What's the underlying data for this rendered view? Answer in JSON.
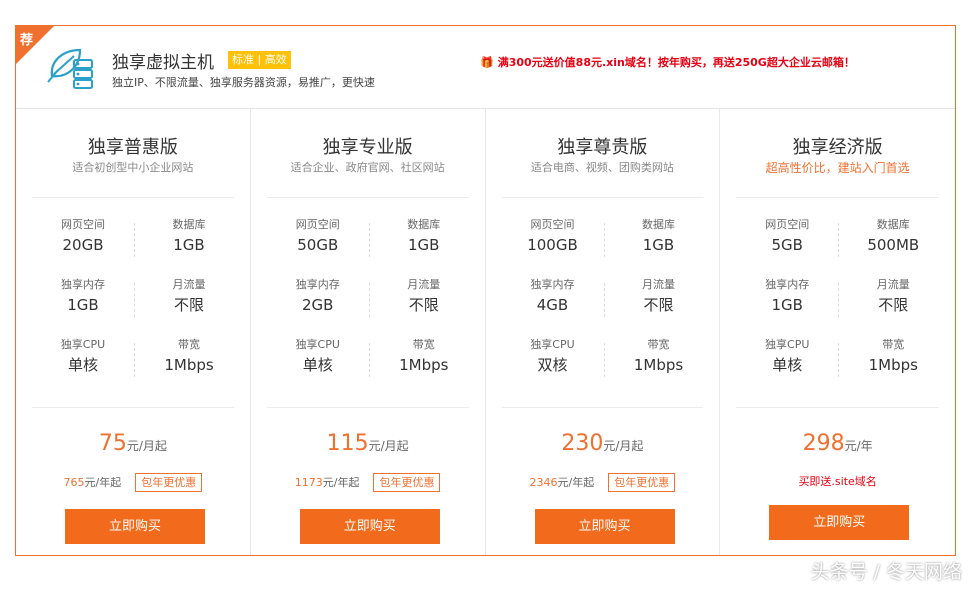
{
  "header": {
    "badge": "荐",
    "title": "独享虚拟主机",
    "tag": "标准 | 高效",
    "subtitle": "独立IP、不限流量、独享服务器资源，易推广，更快速",
    "promo": "满300元送价值88元.xin域名！按年购买，再送250G超大企业云邮箱！"
  },
  "plans": [
    {
      "name": "独享普惠版",
      "desc": "适合初创型中小企业网站",
      "specs": [
        {
          "label": "网页空间",
          "value": "20GB"
        },
        {
          "label": "数据库",
          "value": "1GB"
        },
        {
          "label": "独享内存",
          "value": "1GB"
        },
        {
          "label": "月流量",
          "value": "不限"
        },
        {
          "label": "独享CPU",
          "value": "单核"
        },
        {
          "label": "带宽",
          "value": "1Mbps"
        }
      ],
      "price": "75",
      "price_unit": "元/月起",
      "year_price": "765",
      "year_unit": "元/年起",
      "deal": "包年更优惠",
      "buy": "立即购买"
    },
    {
      "name": "独享专业版",
      "desc": "适合企业、政府官网、社区网站",
      "specs": [
        {
          "label": "网页空间",
          "value": "50GB"
        },
        {
          "label": "数据库",
          "value": "1GB"
        },
        {
          "label": "独享内存",
          "value": "2GB"
        },
        {
          "label": "月流量",
          "value": "不限"
        },
        {
          "label": "独享CPU",
          "value": "单核"
        },
        {
          "label": "带宽",
          "value": "1Mbps"
        }
      ],
      "price": "115",
      "price_unit": "元/月起",
      "year_price": "1173",
      "year_unit": "元/年起",
      "deal": "包年更优惠",
      "buy": "立即购买"
    },
    {
      "name": "独享尊贵版",
      "desc": "适合电商、视频、团购类网站",
      "specs": [
        {
          "label": "网页空间",
          "value": "100GB"
        },
        {
          "label": "数据库",
          "value": "1GB"
        },
        {
          "label": "独享内存",
          "value": "4GB"
        },
        {
          "label": "月流量",
          "value": "不限"
        },
        {
          "label": "独享CPU",
          "value": "双核"
        },
        {
          "label": "带宽",
          "value": "1Mbps"
        }
      ],
      "price": "230",
      "price_unit": "元/月起",
      "year_price": "2346",
      "year_unit": "元/年起",
      "deal": "包年更优惠",
      "buy": "立即购买"
    },
    {
      "name": "独享经济版",
      "desc": "超高性价比，建站入门首选",
      "specs": [
        {
          "label": "网页空间",
          "value": "5GB"
        },
        {
          "label": "数据库",
          "value": "500MB"
        },
        {
          "label": "独享内存",
          "value": "1GB"
        },
        {
          "label": "月流量",
          "value": "不限"
        },
        {
          "label": "独享CPU",
          "value": "单核"
        },
        {
          "label": "带宽",
          "value": "1Mbps"
        }
      ],
      "price": "298",
      "price_unit": "元/年",
      "gift": "买即送.site域名",
      "buy": "立即购买"
    }
  ],
  "watermark": "头条号 / 冬天网络",
  "colors": {
    "accent": "#f07030",
    "button": "#f26a1b",
    "promo": "#e60012",
    "tag": "#ffc107"
  }
}
